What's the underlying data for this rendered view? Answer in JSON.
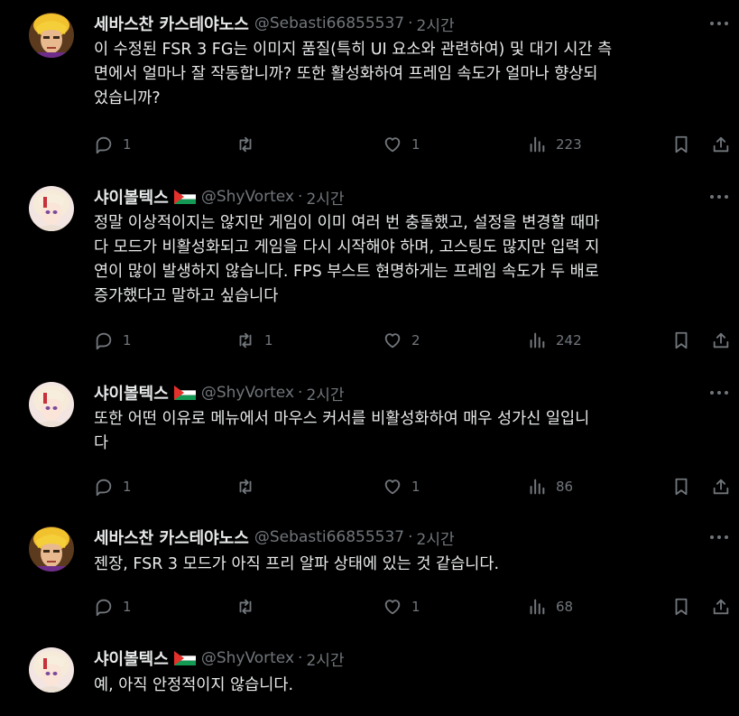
{
  "colors": {
    "background": "#000000",
    "text": "#e7e9ea",
    "muted": "#71767b"
  },
  "tweets": [
    {
      "name": "세바스찬 카스테야노스",
      "handle": "@Sebasti66855537",
      "time": "2시간",
      "avatar": "sebastian-avatar",
      "has_flag": false,
      "text": "이 수정된 FSR 3 FG는 이미지 품질(특히 UI 요소와 관련하여) 및 대기 시간 측\n면에서 얼마나 잘 작동합니까? 또한 활성화하여 프레임 속도가 얼마나 향상되\n었습니까?",
      "replies": "1",
      "retweets": "",
      "likes": "1",
      "views": "223"
    },
    {
      "name": "샤이볼텍스",
      "handle": "@ShyVortex",
      "time": "2시간",
      "avatar": "shyvortex-avatar",
      "has_flag": true,
      "text": "정말 이상적이지는 않지만 게임이 이미 여러 번 충돌했고, 설정을 변경할 때마\n다 모드가 비활성화되고 게임을 다시 시작해야 하며, 고스팅도 많지만 입력 지\n연이 많이 발생하지 않습니다. FPS 부스트 현명하게는 프레임 속도가 두 배로\n증가했다고 말하고 싶습니다",
      "replies": "1",
      "retweets": "1",
      "likes": "2",
      "views": "242"
    },
    {
      "name": "샤이볼텍스",
      "handle": "@ShyVortex",
      "time": "2시간",
      "avatar": "shyvortex-avatar",
      "has_flag": true,
      "text": "또한 어떤 이유로 메뉴에서 마우스 커서를 비활성화하여 매우 성가신 일입니\n다",
      "replies": "1",
      "retweets": "",
      "likes": "1",
      "views": "86"
    },
    {
      "name": "세바스찬 카스테야노스",
      "handle": "@Sebasti66855537",
      "time": "2시간",
      "avatar": "sebastian-avatar",
      "has_flag": false,
      "text": "젠장, FSR 3 모드가 아직 프리 알파 상태에 있는 것 같습니다.",
      "replies": "1",
      "retweets": "",
      "likes": "1",
      "views": "68"
    },
    {
      "name": "샤이볼텍스",
      "handle": "@ShyVortex",
      "time": "2시간",
      "avatar": "shyvortex-avatar",
      "has_flag": true,
      "text": "예, 아직 안정적이지 않습니다.",
      "replies": "",
      "retweets": "",
      "likes": "",
      "views": ""
    }
  ]
}
